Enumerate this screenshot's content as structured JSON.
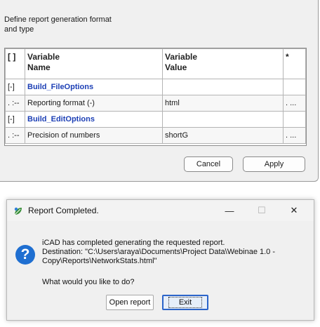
{
  "panel": {
    "description": "Define report generation format and type",
    "columns": [
      "[ ]",
      "Variable Name",
      "Variable Value",
      "*"
    ],
    "rows": [
      {
        "bracket": "[-]",
        "name": "Build_FileOptions",
        "value": "",
        "star": "",
        "group": true
      },
      {
        "bracket": ". :--",
        "name": "Reporting format (-)",
        "value": "html",
        "star": ". ...",
        "group": false
      },
      {
        "bracket": "[-]",
        "name": "Build_EditOptions",
        "value": "",
        "star": "",
        "group": true
      },
      {
        "bracket": ". :--",
        "name": "Precision of numbers",
        "value": "shortG",
        "star": ". ...",
        "group": false
      }
    ],
    "cancel_label": "Cancel",
    "apply_label": "Apply"
  },
  "dialog": {
    "title": "Report Completed.",
    "minimize": "—",
    "maximize": "☐",
    "close": "✕",
    "icon": "question-icon",
    "message_line1": "iCAD has completed generating the requested report.",
    "message_line2": "Destination: \"C:\\Users\\araya\\Documents\\Project Data\\Webinae 1.0 - Copy\\Reports\\NetworkStats.html\"",
    "question": "What would you like to do?",
    "open_label": "Open report",
    "exit_label": "Exit"
  },
  "colors": {
    "group_text": "#1c3fb5",
    "question_icon": "#1f6fd1",
    "default_button_border": "#2b64c9"
  }
}
